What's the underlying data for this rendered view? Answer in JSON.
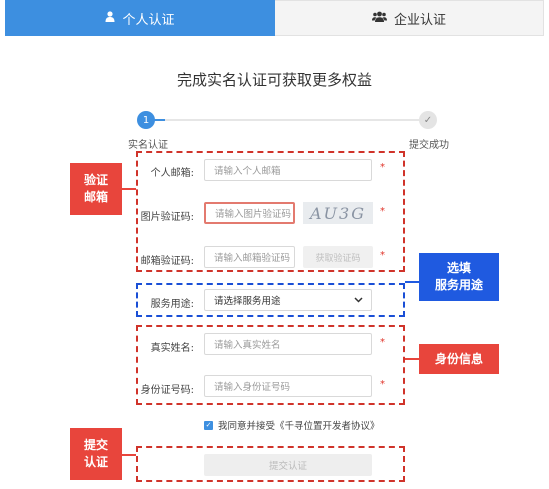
{
  "tabs": {
    "personal": {
      "label": "个人认证",
      "icon": "user-icon"
    },
    "enterprise": {
      "label": "企业认证",
      "icon": "users-icon"
    }
  },
  "page_title": "完成实名认证可获取更多权益",
  "stepper": {
    "step1": {
      "number": "1",
      "label": "实名认证"
    },
    "step2": {
      "mark": "✓",
      "label": "提交成功"
    }
  },
  "form": {
    "email": {
      "label": "个人邮箱:",
      "placeholder": "请输入个人邮箱"
    },
    "image_code": {
      "label": "图片验证码:",
      "placeholder": "请输入图片验证码",
      "captcha_text": "AU3G"
    },
    "email_code": {
      "label": "邮箱验证码:",
      "placeholder": "请输入邮箱验证码",
      "get_code_button": "获取验证码"
    },
    "purpose": {
      "label": "服务用途:",
      "selected": "请选择服务用途"
    },
    "real_name": {
      "label": "真实姓名:",
      "placeholder": "请输入真实姓名"
    },
    "id_number": {
      "label": "身份证号码:",
      "placeholder": "请输入身份证号码"
    },
    "required_mark": "*",
    "agreement": "我同意并接受《千寻位置开发者协议》",
    "submit_button": "提交认证"
  },
  "annotations": {
    "verify_email": "验证\n邮箱",
    "select_purpose": "选填\n服务用途",
    "identity_info": "身份信息",
    "submit_auth": "提交\n认证"
  },
  "colors": {
    "primary": "#3d8fe0",
    "annotation_red": "#e8453c",
    "annotation_blue": "#1f5ae0",
    "required": "#e0342a"
  }
}
